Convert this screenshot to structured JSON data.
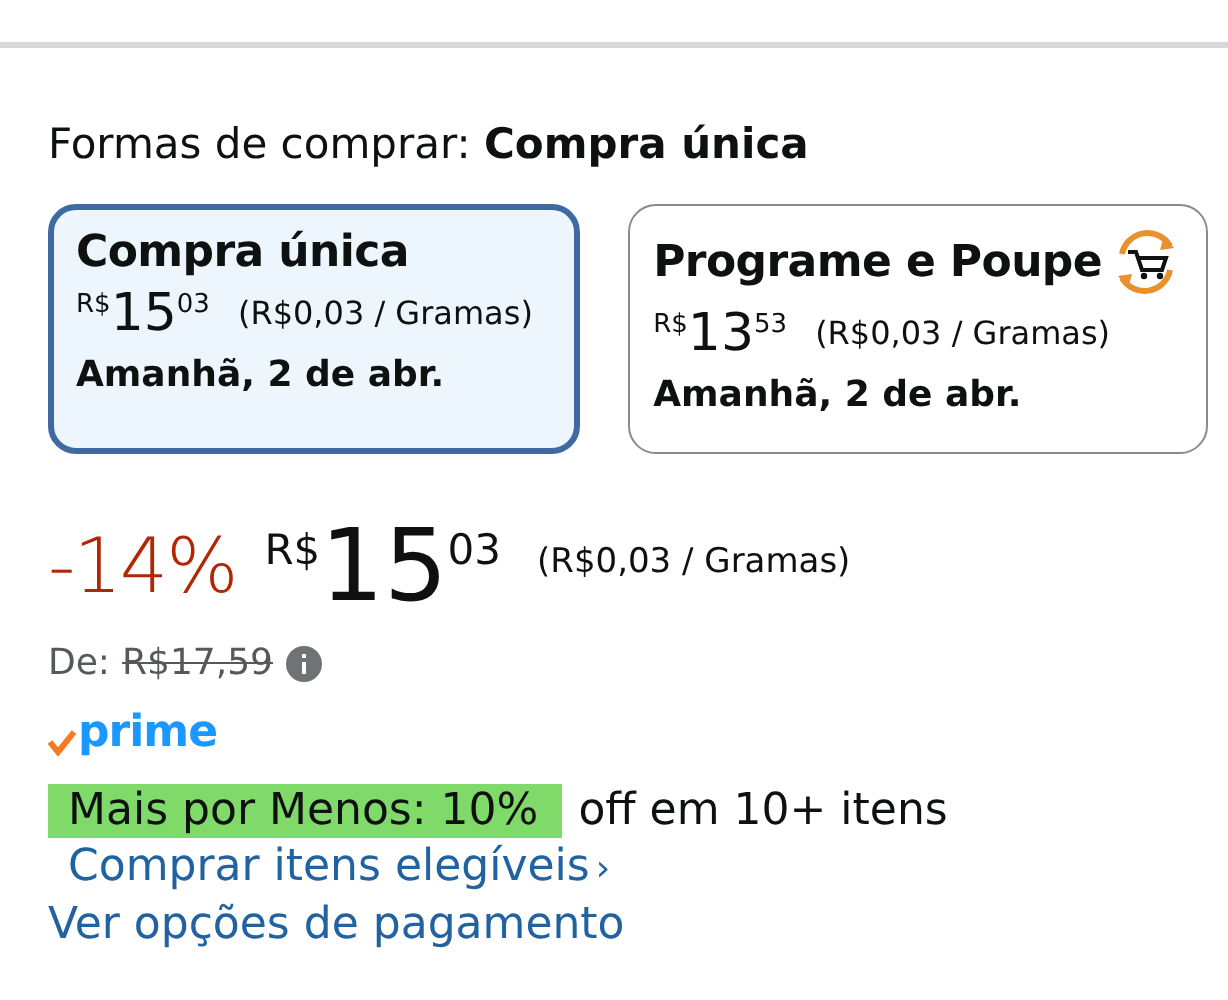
{
  "heading": {
    "label": "Formas de comprar:",
    "value": "Compra única"
  },
  "options": [
    {
      "title": "Compra única",
      "currency": "R$",
      "whole": "15",
      "fraction": "03",
      "unit_price": "(R$0,03 / Gramas)",
      "delivery": "Amanhã, 2 de abr.",
      "selected": true,
      "kind": "single"
    },
    {
      "title": "Programe e Poupe",
      "currency": "R$",
      "whole": "13",
      "fraction": "53",
      "unit_price": "(R$0,03 / Gramas)",
      "delivery": "Amanhã, 2 de abr.",
      "selected": false,
      "kind": "subscribe"
    }
  ],
  "price": {
    "discount": "-14%",
    "currency": "R$",
    "whole": "15",
    "fraction": "03",
    "unit_price": "(R$0,03 / Gramas)"
  },
  "list_price": {
    "label": "De:",
    "value": "R$17,59"
  },
  "prime": "prime",
  "promo": {
    "badge": "Mais por Menos: 10%",
    "text": "off em 10+ itens",
    "link": "Comprar itens elegíveis",
    "chevron": "›"
  },
  "payment_link": "Ver opções de pagamento"
}
